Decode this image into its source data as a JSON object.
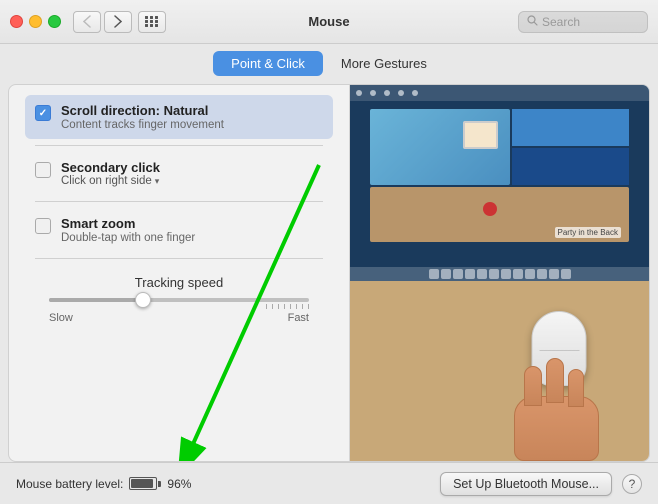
{
  "titlebar": {
    "title": "Mouse",
    "search_placeholder": "Search",
    "back_btn": "‹",
    "forward_btn": "›"
  },
  "tabs": [
    {
      "id": "point-click",
      "label": "Point & Click",
      "active": true
    },
    {
      "id": "more-gestures",
      "label": "More Gestures",
      "active": false
    }
  ],
  "settings": {
    "scroll_direction": {
      "title": "Scroll direction: Natural",
      "subtitle": "Content tracks finger movement",
      "checked": true
    },
    "secondary_click": {
      "title": "Secondary click",
      "subtitle": "Click on right side",
      "checked": false
    },
    "smart_zoom": {
      "title": "Smart zoom",
      "subtitle": "Double-tap with one finger",
      "checked": false
    },
    "tracking_speed": {
      "label": "Tracking speed",
      "slow_label": "Slow",
      "fast_label": "Fast",
      "value": 35
    }
  },
  "bottom_bar": {
    "battery_label": "Mouse battery level:",
    "battery_percent": "96%",
    "bluetooth_btn": "Set Up Bluetooth Mouse...",
    "help_btn": "?"
  }
}
